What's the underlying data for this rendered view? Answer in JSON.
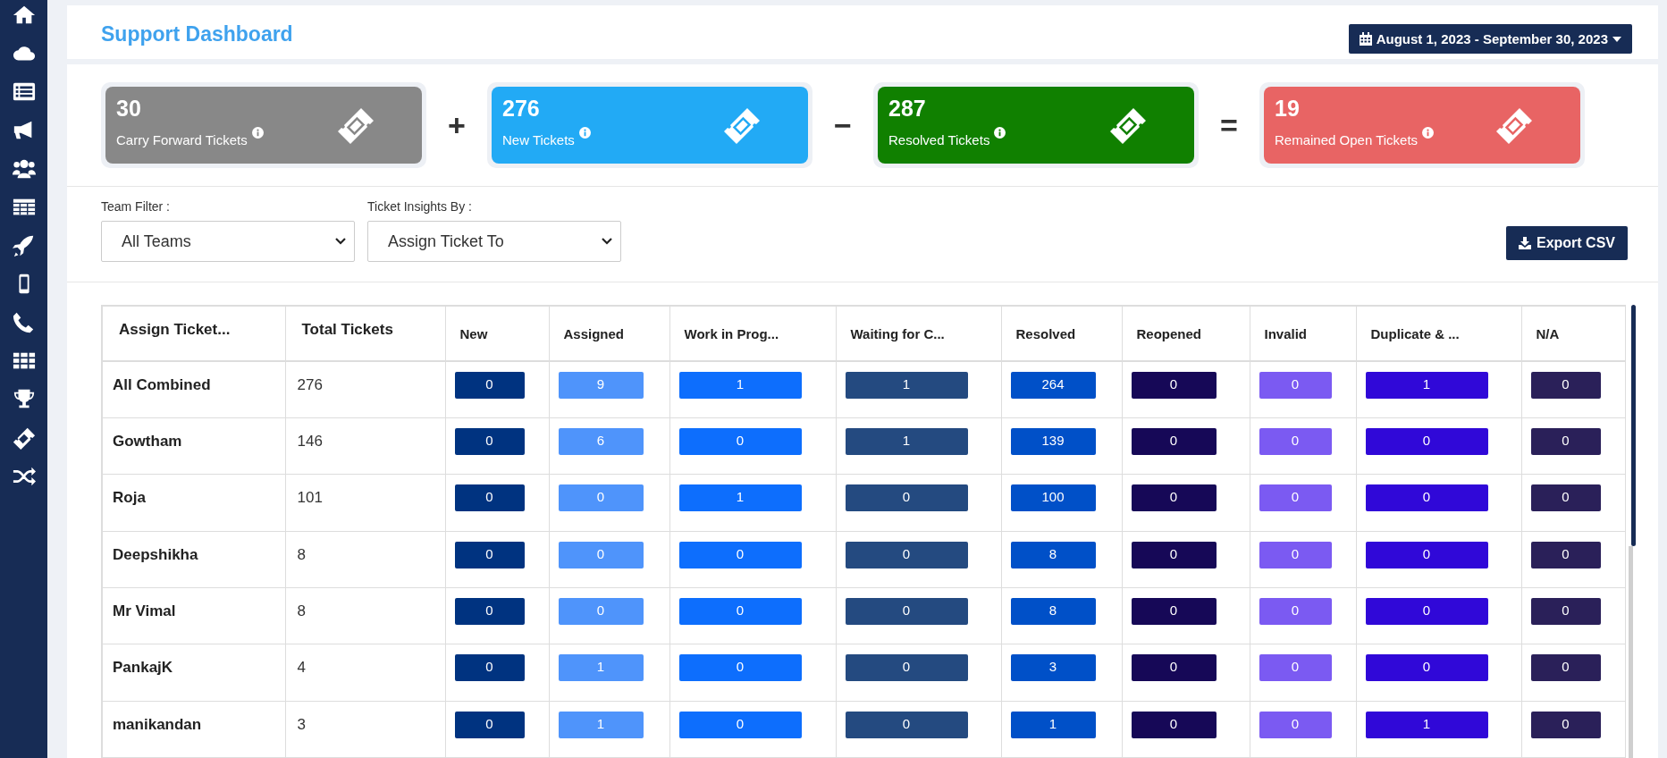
{
  "header": {
    "title": "Support Dashboard",
    "date_range": "August 1, 2023 - September 30, 2023"
  },
  "summary": [
    {
      "value": "30",
      "label": "Carry Forward Tickets",
      "color": "#888888",
      "operator": "+"
    },
    {
      "value": "276",
      "label": "New Tickets",
      "color": "#22aaf5",
      "operator": "−"
    },
    {
      "value": "287",
      "label": "Resolved Tickets",
      "color": "#108000",
      "operator": "="
    },
    {
      "value": "19",
      "label": "Remained Open Tickets",
      "color": "#e86464"
    }
  ],
  "filters": [
    {
      "label": "Team Filter :",
      "value": "All Teams"
    },
    {
      "label": "Ticket Insights By :",
      "value": "Assign Ticket To"
    }
  ],
  "export_button": "Export CSV",
  "table": {
    "columns": [
      {
        "label": "Assign Ticket..."
      },
      {
        "label": "Total Tickets"
      },
      {
        "label": "New",
        "color": "#003380"
      },
      {
        "label": "Assigned",
        "color": "#4f94fb"
      },
      {
        "label": "Work in Prog...",
        "color": "#0d6efd"
      },
      {
        "label": "Waiting for C...",
        "color": "#244a80"
      },
      {
        "label": "Resolved",
        "color": "#0050c8"
      },
      {
        "label": "Reopened",
        "color": "#160857"
      },
      {
        "label": "Invalid",
        "color": "#7b5af2"
      },
      {
        "label": "Duplicate & ...",
        "color": "#3008d8"
      },
      {
        "label": "N/A",
        "color": "#2a2059"
      }
    ],
    "rows": [
      [
        "All Combined",
        "276",
        "0",
        "9",
        "1",
        "1",
        "264",
        "0",
        "0",
        "1",
        "0"
      ],
      [
        "Gowtham",
        "146",
        "0",
        "6",
        "0",
        "1",
        "139",
        "0",
        "0",
        "0",
        "0"
      ],
      [
        "Roja",
        "101",
        "0",
        "0",
        "1",
        "0",
        "100",
        "0",
        "0",
        "0",
        "0"
      ],
      [
        "Deepshikha",
        "8",
        "0",
        "0",
        "0",
        "0",
        "8",
        "0",
        "0",
        "0",
        "0"
      ],
      [
        "Mr Vimal",
        "8",
        "0",
        "0",
        "0",
        "0",
        "8",
        "0",
        "0",
        "0",
        "0"
      ],
      [
        "PankajK",
        "4",
        "0",
        "1",
        "0",
        "0",
        "3",
        "0",
        "0",
        "0",
        "0"
      ],
      [
        "manikandan",
        "3",
        "0",
        "1",
        "0",
        "0",
        "1",
        "0",
        "0",
        "1",
        "0"
      ]
    ]
  }
}
